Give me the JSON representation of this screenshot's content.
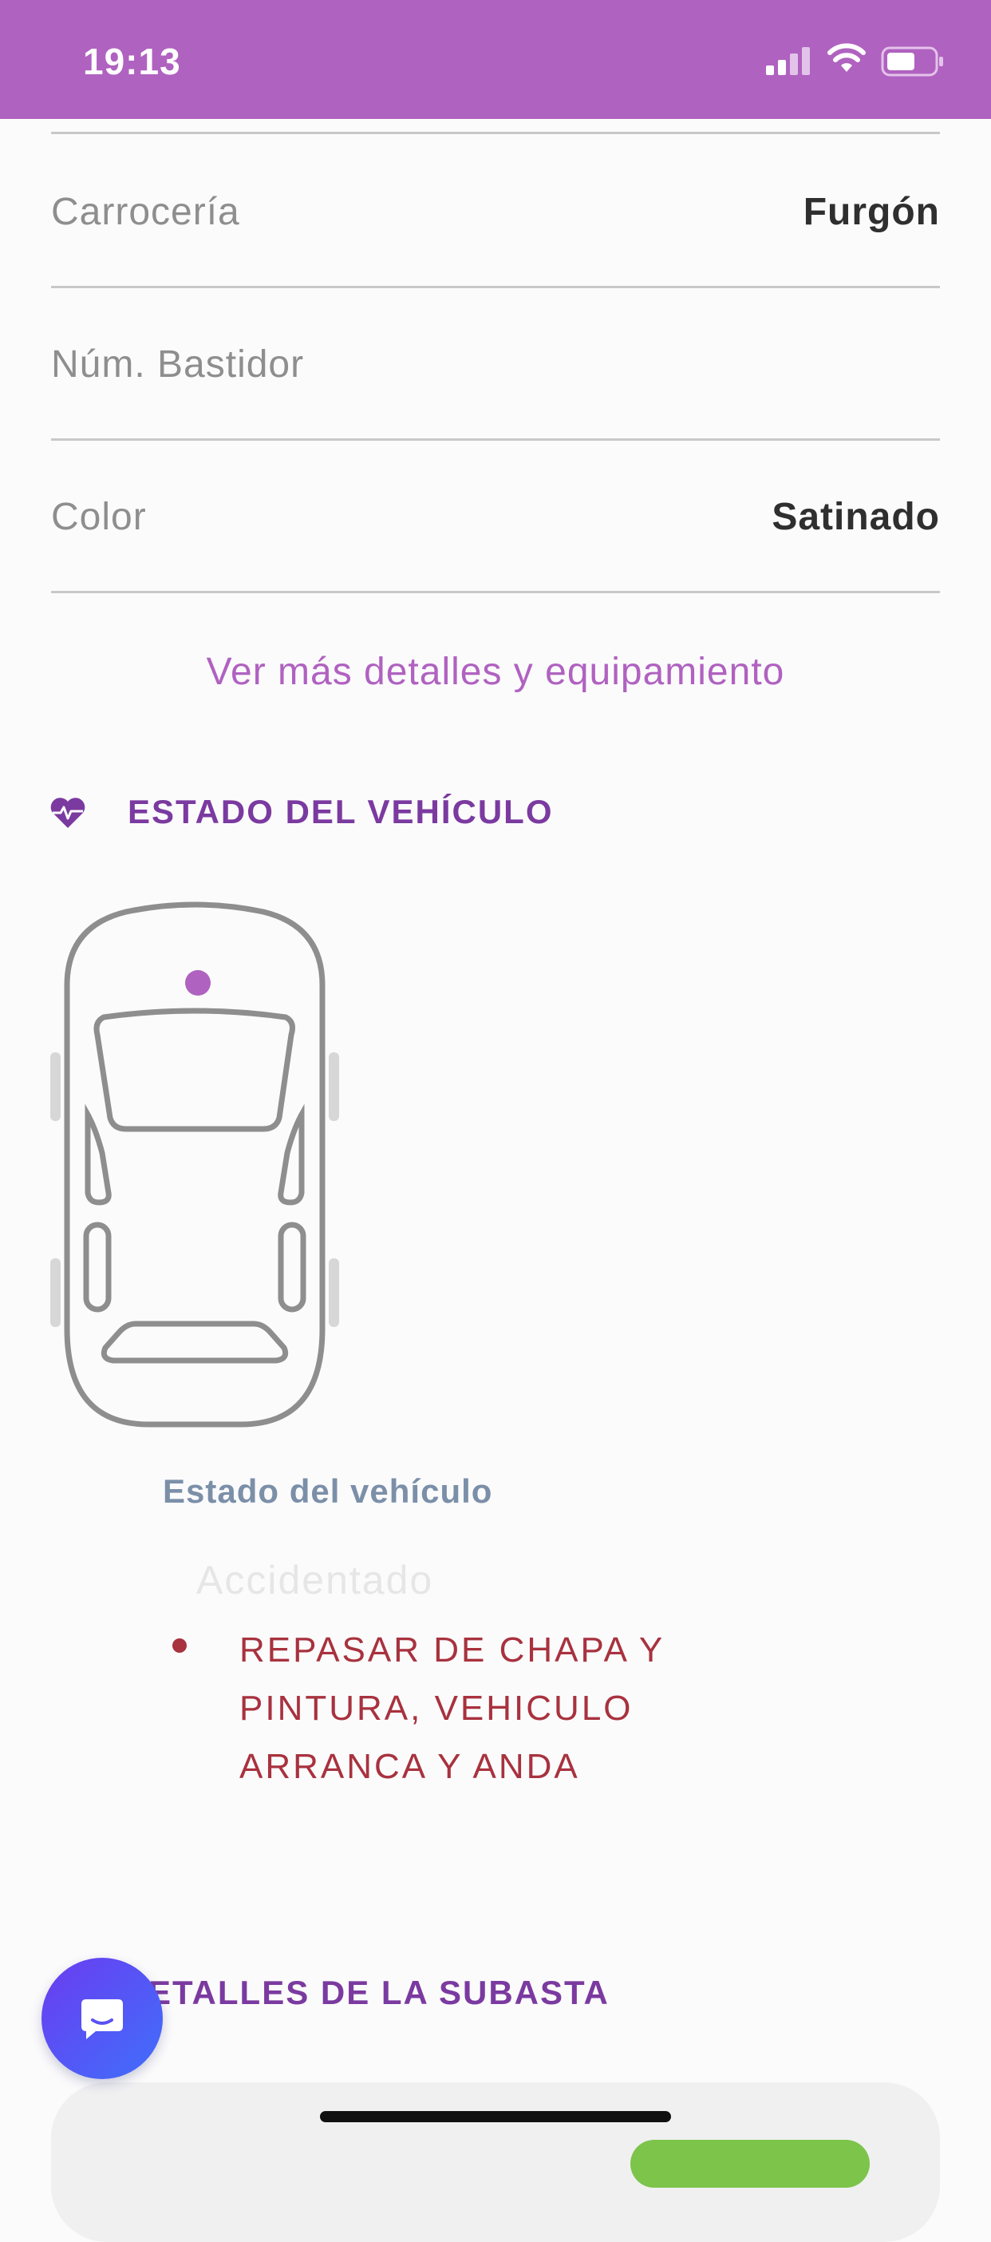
{
  "status_bar": {
    "time": "19:13",
    "background": "#b062c0"
  },
  "details": [
    {
      "label": "Carrocería",
      "value": "Furgón"
    },
    {
      "label": "Núm. Bastidor",
      "value": ""
    },
    {
      "label": "Color",
      "value": "Satinado"
    }
  ],
  "more_details_link": "Ver más detalles y equipamiento",
  "vehicle_state": {
    "heading": "ESTADO DEL VEHÍCULO",
    "icon": "heart-pulse-icon",
    "state_label": "Estado del vehículo",
    "state_value": "Accidentado",
    "damage_note": "REPASAR DE CHAPA Y\nPINTURA, VEHICULO\nARRANCA Y ANDA"
  },
  "auction": {
    "heading": "ETALLES DE LA SUBASTA"
  },
  "chat_button": {
    "icon": "chat-bubble-icon"
  },
  "colors": {
    "accent": "#b062c0",
    "heading": "#7b3aa0",
    "damage": "#a8323e"
  }
}
